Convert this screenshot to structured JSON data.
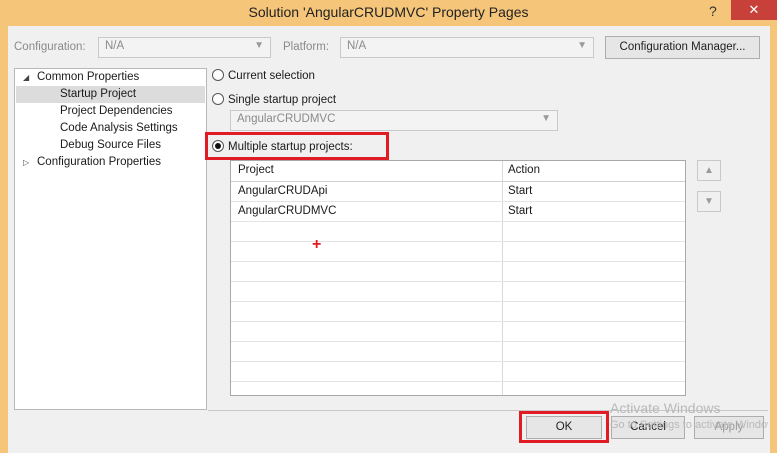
{
  "window": {
    "title": "Solution 'AngularCRUDMVC' Property Pages",
    "help_glyph": "?",
    "close_glyph": "✕"
  },
  "toolbar": {
    "configuration_label": "Configuration:",
    "configuration_value": "N/A",
    "platform_label": "Platform:",
    "platform_value": "N/A",
    "config_manager_label": "Configuration Manager..."
  },
  "tree": {
    "items": [
      {
        "label": "Common Properties",
        "expanded": true
      },
      {
        "label": "Startup Project",
        "selected": true
      },
      {
        "label": "Project Dependencies"
      },
      {
        "label": "Code Analysis Settings"
      },
      {
        "label": "Debug Source Files"
      },
      {
        "label": "Configuration Properties",
        "expanded": false
      }
    ]
  },
  "startup": {
    "current_selection": "Current selection",
    "single_startup": "Single startup project",
    "single_startup_value": "AngularCRUDMVC",
    "multiple_startup": "Multiple startup projects:",
    "selected_option": "multiple"
  },
  "grid": {
    "columns": [
      "Project",
      "Action"
    ],
    "rows": [
      {
        "project": "AngularCRUDApi",
        "action": "Start"
      },
      {
        "project": "AngularCRUDMVC",
        "action": "Start"
      }
    ]
  },
  "buttons": {
    "ok": "OK",
    "cancel": "Cancel",
    "apply": "Apply",
    "move_up_glyph": "▲",
    "move_down_glyph": "▼"
  },
  "watermark": {
    "line1": "Activate Windows",
    "line2": "Go to Settings to activate Windows."
  },
  "colors": {
    "highlight": "#e01b24",
    "titlebar": "#f5c57a",
    "close": "#c7413a"
  }
}
